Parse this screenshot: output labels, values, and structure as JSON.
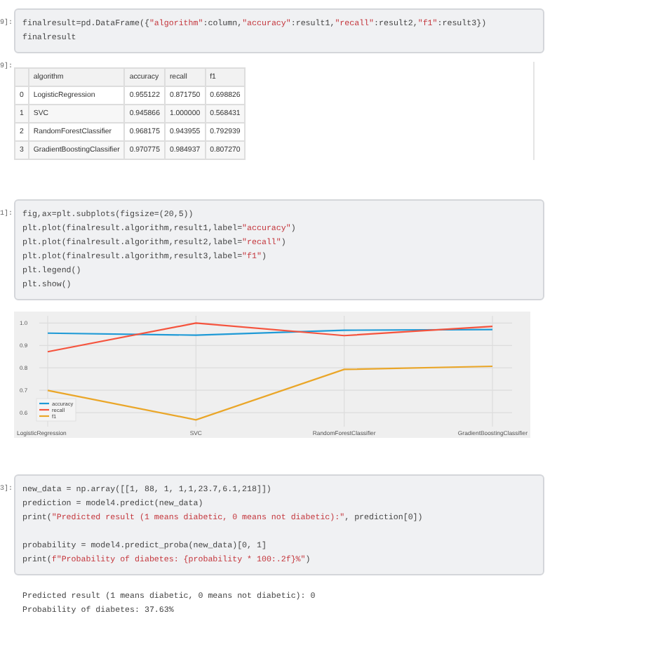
{
  "cells": [
    {
      "kind": "code",
      "prompt": "9]:",
      "lines": [
        {
          "kind": "code",
          "segments": [
            {
              "text": "finalresult=pd.DataFrame({",
              "kind": "plain"
            },
            {
              "text": "\"algorithm\"",
              "kind": "string"
            },
            {
              "text": ":column,",
              "kind": "plain"
            },
            {
              "text": "\"accuracy\"",
              "kind": "string"
            },
            {
              "text": ":result1,",
              "kind": "plain"
            },
            {
              "text": "\"recall\"",
              "kind": "string"
            },
            {
              "text": ":result2,",
              "kind": "plain"
            },
            {
              "text": "\"f1\"",
              "kind": "string"
            },
            {
              "text": ":result3})",
              "kind": "plain"
            }
          ]
        },
        {
          "kind": "code",
          "segments": [
            {
              "text": "finalresult",
              "kind": "plain"
            }
          ]
        }
      ]
    },
    {
      "kind": "table",
      "prompt": "9]:",
      "columns": [
        "",
        "algorithm",
        "accuracy",
        "recall",
        "f1"
      ],
      "rows": [
        [
          "0",
          "LogisticRegression",
          "0.955122",
          "0.871750",
          "0.698826"
        ],
        [
          "1",
          "SVC",
          "0.945866",
          "1.000000",
          "0.568431"
        ],
        [
          "2",
          "RandomForestClassifier",
          "0.968175",
          "0.943955",
          "0.792939"
        ],
        [
          "3",
          "GradientBoostingClassifier",
          "0.970775",
          "0.984937",
          "0.807270"
        ]
      ]
    },
    {
      "kind": "code",
      "prompt": "1]:",
      "lines": [
        {
          "kind": "code",
          "segments": [
            {
              "text": "fig,ax=plt.subplots(figsize=(20,5))",
              "kind": "plain"
            }
          ]
        },
        {
          "kind": "code",
          "segments": [
            {
              "text": "plt.plot(finalresult.algorithm,result1,label=",
              "kind": "plain"
            },
            {
              "text": "\"accuracy\"",
              "kind": "string"
            },
            {
              "text": ")",
              "kind": "plain"
            }
          ]
        },
        {
          "kind": "code",
          "segments": [
            {
              "text": "plt.plot(finalresult.algorithm,result2,label=",
              "kind": "plain"
            },
            {
              "text": "\"recall\"",
              "kind": "string"
            },
            {
              "text": ")",
              "kind": "plain"
            }
          ]
        },
        {
          "kind": "code",
          "segments": [
            {
              "text": "plt.plot(finalresult.algorithm,result3,label=",
              "kind": "plain"
            },
            {
              "text": "\"f1\"",
              "kind": "string"
            },
            {
              "text": ")",
              "kind": "plain"
            }
          ]
        },
        {
          "kind": "code",
          "segments": [
            {
              "text": "plt.legend()",
              "kind": "plain"
            }
          ]
        },
        {
          "kind": "code",
          "segments": [
            {
              "text": "plt.show()",
              "kind": "plain"
            }
          ]
        }
      ]
    },
    {
      "kind": "chart",
      "chart_data": {
        "type": "line",
        "categories": [
          "LogisticRegression",
          "SVC",
          "RandomForestClassifier",
          "GradientBoostingClassifier"
        ],
        "yticks": [
          0.6,
          0.7,
          0.8,
          0.9,
          {
            "value": 1,
            "label": "1.0"
          }
        ],
        "ylim": [
          0.55,
          1.02
        ],
        "grid": true,
        "legend": true,
        "series": [
          {
            "name": "accuracy",
            "color": "#1f9ad6",
            "values": [
              0.955,
              0.946,
              0.968,
              0.971
            ]
          },
          {
            "name": "recall",
            "color": "#f5533d",
            "values": [
              0.872,
              1.0,
              0.944,
              0.985
            ]
          },
          {
            "name": "f1",
            "color": "#eaa628",
            "values": [
              0.699,
              0.568,
              0.793,
              0.807
            ]
          }
        ]
      }
    },
    {
      "kind": "code",
      "prompt": "3]:",
      "lines": [
        {
          "kind": "code",
          "segments": [
            {
              "text": "new_data = np.array([[1, 88, 1, 1,1,23.7,6.1,218]])",
              "kind": "plain"
            }
          ]
        },
        {
          "kind": "code",
          "segments": [
            {
              "text": "prediction = model4.predict(new_data)",
              "kind": "plain"
            }
          ]
        },
        {
          "kind": "code",
          "segments": [
            {
              "text": "print(",
              "kind": "plain"
            },
            {
              "text": "\"Predicted result (1 means diabetic, 0 means not diabetic):\"",
              "kind": "string"
            },
            {
              "text": ", prediction[0])",
              "kind": "plain"
            }
          ]
        },
        {
          "kind": "blank"
        },
        {
          "kind": "code",
          "segments": [
            {
              "text": "probability = model4.predict_proba(new_data)[0, 1]",
              "kind": "plain"
            }
          ]
        },
        {
          "kind": "code",
          "segments": [
            {
              "text": "print(",
              "kind": "plain"
            },
            {
              "text": "f\"Probability of diabetes: {probability * 100:.2f}%\"",
              "kind": "string"
            },
            {
              "text": ")",
              "kind": "plain"
            }
          ]
        }
      ]
    },
    {
      "kind": "output",
      "lines": [
        "Predicted result (1 means diabetic, 0 means not diabetic): 0",
        "Probability of diabetes: 37.63%"
      ]
    }
  ]
}
